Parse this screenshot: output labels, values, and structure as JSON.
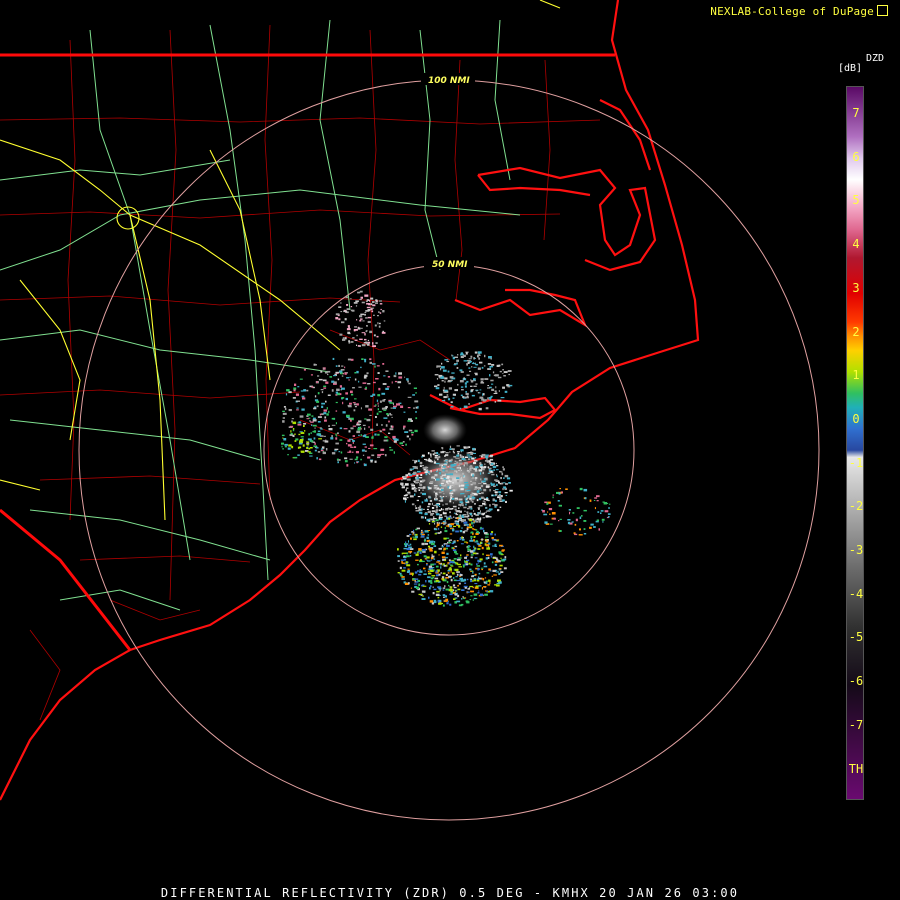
{
  "header": {
    "credit": "NEXLAB-College of DuPage"
  },
  "footer": {
    "caption": "DIFFERENTIAL REFLECTIVITY (ZDR) 0.5 DEG - KMHX 20 JAN 26 03:00"
  },
  "colorbar": {
    "product": "DZD",
    "unit": "[dB]",
    "ticks": [
      "7",
      "6",
      "5",
      "4",
      "3",
      "2",
      "1",
      "0",
      "-1",
      "-2",
      "-3",
      "-4",
      "-5",
      "-6",
      "-7",
      "TH"
    ],
    "gradient_stops": [
      {
        "offset": "0%",
        "color": "#5a0a66"
      },
      {
        "offset": "7%",
        "color": "#b070c0"
      },
      {
        "offset": "10%",
        "color": "#e0c8ec"
      },
      {
        "offset": "13%",
        "color": "#ffffff"
      },
      {
        "offset": "17%",
        "color": "#f3a6c4"
      },
      {
        "offset": "20%",
        "color": "#e06890"
      },
      {
        "offset": "24%",
        "color": "#b01830"
      },
      {
        "offset": "29%",
        "color": "#e00000"
      },
      {
        "offset": "33%",
        "color": "#ff3a00"
      },
      {
        "offset": "35%",
        "color": "#ff9000"
      },
      {
        "offset": "37%",
        "color": "#ffd000"
      },
      {
        "offset": "40%",
        "color": "#b0e000"
      },
      {
        "offset": "43%",
        "color": "#30c060"
      },
      {
        "offset": "45%",
        "color": "#20b0b8"
      },
      {
        "offset": "48%",
        "color": "#3070d0"
      },
      {
        "offset": "51%",
        "color": "#2848a0"
      },
      {
        "offset": "52%",
        "color": "#e8e8e8"
      },
      {
        "offset": "60%",
        "color": "#a8a8a8"
      },
      {
        "offset": "68%",
        "color": "#686868"
      },
      {
        "offset": "76%",
        "color": "#303030"
      },
      {
        "offset": "84%",
        "color": "#140a18"
      },
      {
        "offset": "100%",
        "color": "#6a0a70"
      }
    ]
  },
  "range_rings": [
    {
      "label": "50 NMI"
    },
    {
      "label": "100 NMI"
    }
  ],
  "colors": {
    "state_border": "#ff0a0a",
    "county_border": "#b00000",
    "highway": "#80e090",
    "interstate": "#ffff30",
    "range_ring": "#e0a0a0",
    "label_text": "#ffff40"
  }
}
